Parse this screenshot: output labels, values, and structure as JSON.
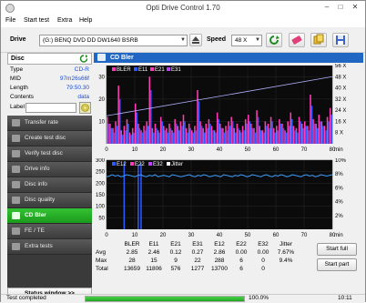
{
  "app": {
    "title": "Opti Drive Control 1.70"
  },
  "menu": [
    "File",
    "Start test",
    "Extra",
    "Help"
  ],
  "drivebar": {
    "drive_label": "Drive",
    "drive_value": "(G:)  BENQ DVD DD DW1640 BSRB",
    "speed_label": "Speed",
    "speed_value": "48 X"
  },
  "disc": {
    "header": "Disc",
    "rows": [
      {
        "key": "Type",
        "value": "CD-R"
      },
      {
        "key": "MID",
        "value": "97m26s66f"
      },
      {
        "key": "Length",
        "value": "79:50.30"
      },
      {
        "key": "Contents",
        "value": "data"
      }
    ],
    "label_key": "Label"
  },
  "nav": {
    "items": [
      "Transfer rate",
      "Create test disc",
      "Verify test disc",
      "Drive info",
      "Disc info",
      "Disc quality",
      "CD Bler",
      "FE / TE",
      "Extra tests"
    ],
    "active_index": 6,
    "status_window": "Status window >>"
  },
  "chart": {
    "header": "CD Bler",
    "top": {
      "legend": [
        "BLER",
        "E11",
        "E21",
        "E31"
      ],
      "legend_colors": [
        "#ff3bb5",
        "#2b5cff",
        "#ff3bb5",
        "#c040ff"
      ],
      "right_ticks": [
        "56 X",
        "48 X",
        "40 X",
        "32 X",
        "24 X",
        "16 X",
        "8 X"
      ],
      "y_ticks": [
        "30",
        "20",
        "10"
      ],
      "x_ticks": [
        "0",
        "10",
        "20",
        "30",
        "40",
        "50",
        "60",
        "70",
        "80"
      ],
      "x_unit": "min"
    },
    "bottom": {
      "legend": [
        "E12",
        "E22",
        "E32",
        "Jitter"
      ],
      "legend_colors": [
        "#2b5cff",
        "#ff3bb5",
        "#c040ff",
        "#ffffff"
      ],
      "y_ticks": [
        "300",
        "250",
        "200",
        "150",
        "100",
        "50"
      ],
      "right_ticks": [
        "10%",
        "8%",
        "6%",
        "4%",
        "2%"
      ],
      "x_ticks": [
        "0",
        "10",
        "20",
        "30",
        "40",
        "50",
        "60",
        "70",
        "80"
      ],
      "x_unit": "min",
      "jitter_color": "#3fa0ff"
    }
  },
  "chart_data": [
    {
      "type": "bar",
      "title": "",
      "xlabel": "min",
      "ylabel": "",
      "xlim": [
        0,
        80
      ],
      "ylim": [
        0,
        35
      ],
      "series": [
        {
          "name": "BLER",
          "values": [
            12,
            9,
            7,
            10,
            26,
            6,
            8,
            11,
            5,
            7,
            18,
            9,
            6,
            8,
            10,
            30,
            7,
            9,
            6,
            12,
            8,
            7,
            9,
            6,
            11,
            8,
            10,
            13,
            7,
            9,
            6,
            8,
            24,
            10,
            7,
            9,
            11,
            8,
            6,
            14,
            9,
            7,
            8,
            10,
            12,
            7,
            9,
            6,
            8,
            11,
            13,
            9,
            7,
            15,
            8,
            6,
            10,
            9,
            12,
            7,
            8,
            11,
            9,
            6,
            10,
            14,
            8,
            7,
            12,
            9,
            10,
            8,
            22,
            11,
            9,
            13,
            10,
            8,
            12,
            16
          ]
        },
        {
          "name": "E11",
          "values": [
            9,
            7,
            5,
            8,
            20,
            4,
            6,
            9,
            4,
            5,
            14,
            7,
            5,
            6,
            8,
            24,
            5,
            7,
            5,
            10,
            6,
            5,
            7,
            5,
            9,
            6,
            8,
            10,
            5,
            7,
            5,
            6,
            19,
            8,
            5,
            7,
            9,
            6,
            5,
            11,
            7,
            5,
            6,
            8,
            10,
            5,
            7,
            5,
            6,
            9,
            10,
            7,
            5,
            12,
            6,
            5,
            8,
            7,
            10,
            5,
            6,
            9,
            7,
            5,
            8,
            11,
            6,
            5,
            10,
            7,
            8,
            6,
            17,
            9,
            7,
            10,
            8,
            6,
            10,
            13
          ]
        }
      ],
      "speed_curve_x": [
        0,
        80
      ],
      "speed_curve_y": [
        20,
        48
      ]
    },
    {
      "type": "bar",
      "title": "",
      "xlabel": "min",
      "ylabel": "",
      "xlim": [
        0,
        80
      ],
      "ylim": [
        0,
        300
      ],
      "y2lim_percent": [
        0,
        10
      ],
      "series": [
        {
          "name": "E12",
          "values": [
            0,
            0,
            0,
            0,
            0,
            0,
            0,
            0,
            0,
            0,
            0,
            0,
            0,
            0,
            0,
            0,
            0,
            0,
            0,
            0,
            0,
            0,
            0,
            0,
            0,
            0,
            0,
            0,
            0,
            0,
            0,
            0,
            0,
            0,
            0,
            0,
            0,
            0,
            0,
            0,
            0,
            0,
            0,
            0,
            0,
            0,
            0,
            0,
            0,
            0,
            0,
            0,
            0,
            0,
            0,
            0,
            0,
            0,
            0,
            0,
            0,
            0,
            0,
            0,
            0,
            0,
            0,
            0,
            0,
            0,
            0,
            0,
            0,
            0,
            0,
            0,
            0,
            0,
            0,
            0
          ]
        },
        {
          "name": "Jitter",
          "values": [
            7.6,
            7.7,
            7.9,
            7.7,
            7.8,
            7.6,
            7.7,
            7.9,
            7.8,
            7.7,
            7.6,
            7.8,
            7.9,
            7.7,
            7.6,
            7.8,
            7.7,
            7.9,
            7.6,
            7.7,
            7.8,
            7.7,
            7.6,
            7.9,
            7.8,
            7.7,
            7.6,
            7.7,
            7.8,
            7.9,
            7.7,
            7.6,
            7.8,
            7.7,
            7.9,
            7.8,
            7.6,
            7.7,
            7.8,
            7.7,
            7.6,
            7.9,
            7.8,
            7.7,
            7.6,
            7.8,
            7.7,
            7.9,
            7.8,
            7.6,
            7.7,
            7.9,
            7.8,
            7.7,
            7.6,
            7.8,
            7.9,
            7.7,
            7.6,
            7.8,
            7.7,
            7.9,
            7.8,
            7.6,
            7.7,
            7.9,
            7.8,
            7.7,
            7.6,
            7.8,
            7.9,
            7.7,
            7.8,
            7.6,
            7.7,
            7.9,
            7.8,
            7.7,
            7.8,
            7.9
          ]
        }
      ]
    }
  ],
  "stats": {
    "columns": [
      "BLER",
      "E11",
      "E21",
      "E31",
      "E12",
      "E22",
      "E32",
      "Jitter"
    ],
    "rows": [
      {
        "label": "Avg",
        "values": [
          "2.85",
          "2.46",
          "0.12",
          "0.27",
          "2.86",
          "0.00",
          "0.00",
          "7.67%"
        ]
      },
      {
        "label": "Max",
        "values": [
          "28",
          "15",
          "9",
          "22",
          "288",
          "6",
          "0",
          "9.4%"
        ]
      },
      {
        "label": "Total",
        "values": [
          "13659",
          "11806",
          "576",
          "1277",
          "13700",
          "6",
          "0",
          ""
        ]
      }
    ],
    "start_full": "Start full",
    "start_part": "Start part"
  },
  "status": {
    "text": "Test completed",
    "percent": "100.0%",
    "time": "10:11",
    "progress": 1.0
  }
}
